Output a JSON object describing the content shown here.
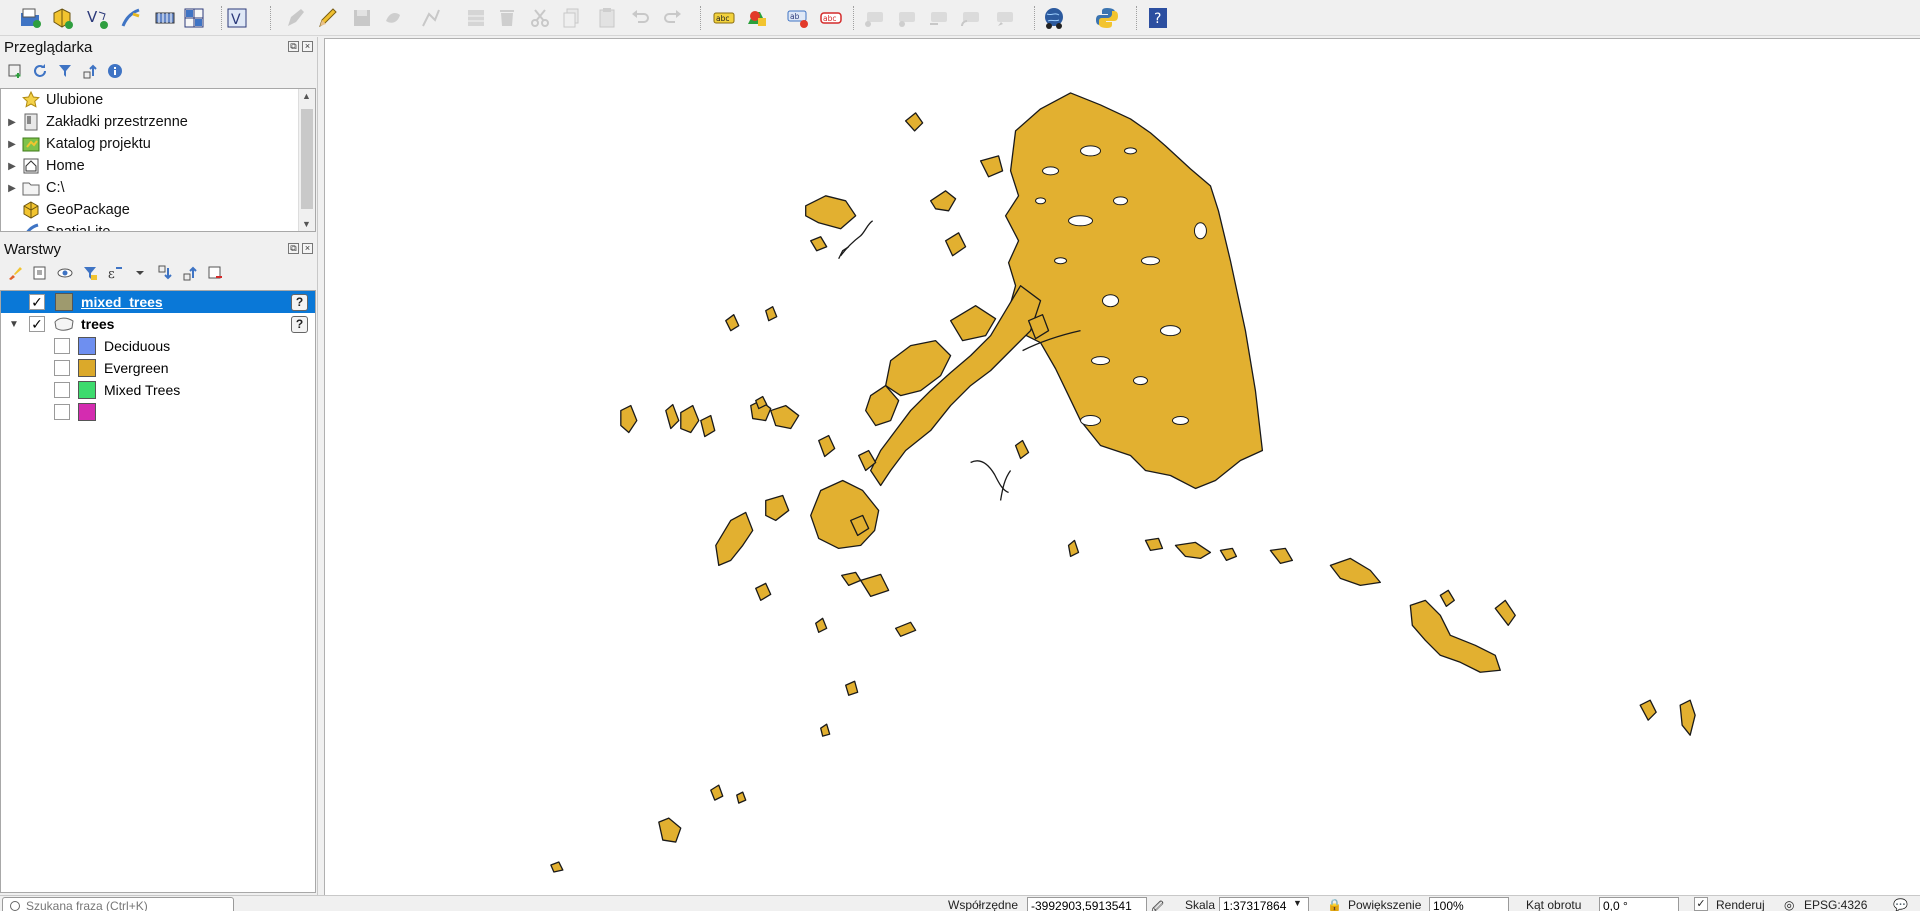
{
  "toolbar": {
    "buttons": [
      "open-project-icon",
      "new-geopackage-icon",
      "new-shapefile-icon",
      "new-spatialite-icon",
      "new-temp-layer-icon",
      "new-virtual-layer-icon",
      "data-source-manager-icon",
      "current-edits-icon",
      "toggle-editing-icon",
      "save-edits-icon",
      "digitize-icon",
      "vertex-tool-icon",
      "modify-attributes-icon",
      "delete-selected-icon",
      "cut-features-icon",
      "copy-features-icon",
      "paste-features-icon",
      "undo-icon",
      "redo-icon",
      "label-abc-icon",
      "diagram-options-icon",
      "layer-labeling-icon",
      "abc-red-icon",
      "pin-labels-icon",
      "show-hide-labels-icon",
      "move-label-icon",
      "rotate-label-icon",
      "change-label-icon",
      "globe-plugin-icon",
      "python-console-icon",
      "help-icon"
    ]
  },
  "browser_panel": {
    "title": "Przeglądarka",
    "items": [
      {
        "label": "Ulubione",
        "icon": "star-icon",
        "expandable": false
      },
      {
        "label": "Zakładki przestrzenne",
        "icon": "bookmark-icon",
        "expandable": true
      },
      {
        "label": "Katalog projektu",
        "icon": "project-folder-icon",
        "expandable": true
      },
      {
        "label": "Home",
        "icon": "home-icon",
        "expandable": true
      },
      {
        "label": "C:\\",
        "icon": "folder-icon",
        "expandable": true
      },
      {
        "label": "GeoPackage",
        "icon": "geopackage-icon",
        "expandable": false
      },
      {
        "label": "SpatiaLite",
        "icon": "spatialite-icon",
        "expandable": false
      }
    ]
  },
  "layers_panel": {
    "title": "Warstwy",
    "layers": [
      {
        "name": "mixed_trees",
        "checked": true,
        "selected": true,
        "swatch": "#9e9a6e"
      },
      {
        "name": "trees",
        "checked": true,
        "selected": false,
        "expanded": true
      }
    ],
    "legend": [
      {
        "label": "Deciduous",
        "color": "#6e8ff0",
        "checked": false
      },
      {
        "label": "Evergreen",
        "color": "#dba92a",
        "checked": false
      },
      {
        "label": "Mixed Trees",
        "color": "#3ddb6d",
        "checked": false
      },
      {
        "label": "",
        "color": "#d42cb0",
        "checked": false
      }
    ]
  },
  "map": {
    "fill_color": "#e2b030",
    "stroke_color": "#1a1a1a"
  },
  "statusbar": {
    "search_placeholder": "Szukana fraza (Ctrl+K)",
    "coord_label": "Współrzędne",
    "coord_value": "-3992903,5913541",
    "scale_label": "Skala",
    "scale_value": "1:37317864",
    "magnify_label": "Powiększenie",
    "magnify_value": "100%",
    "rotation_label": "Kąt obrotu",
    "rotation_value": "0,0 °",
    "render_label": "Renderuj",
    "crs_label": "EPSG:4326"
  }
}
